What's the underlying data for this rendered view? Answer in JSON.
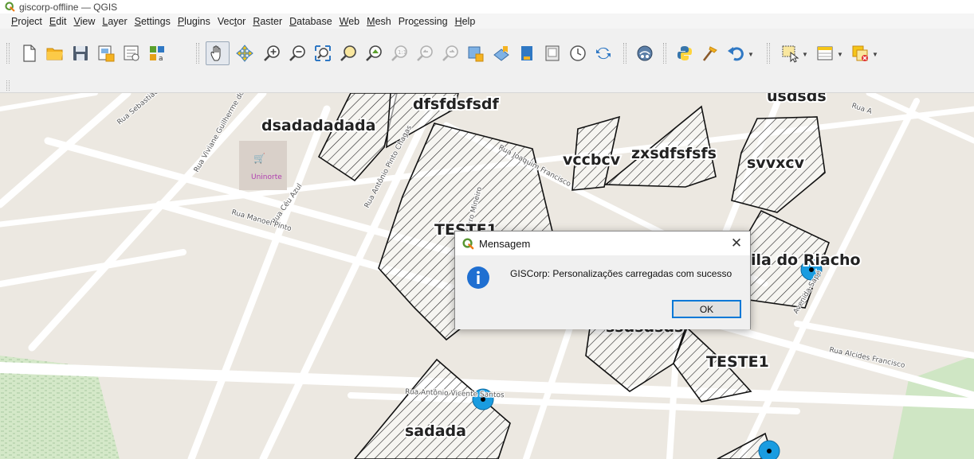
{
  "window": {
    "title": "giscorp-offline — QGIS"
  },
  "menu": {
    "items": [
      {
        "mnemonic": "P",
        "rest": "roject"
      },
      {
        "mnemonic": "E",
        "rest": "dit"
      },
      {
        "mnemonic": "V",
        "rest": "iew"
      },
      {
        "mnemonic": "L",
        "rest": "ayer"
      },
      {
        "mnemonic": "S",
        "rest": "ettings"
      },
      {
        "mnemonic": "P",
        "rest": "lugins"
      },
      {
        "pre": "Vec",
        "mnemonic": "t",
        "rest": "or"
      },
      {
        "mnemonic": "R",
        "rest": "aster"
      },
      {
        "mnemonic": "D",
        "rest": "atabase"
      },
      {
        "mnemonic": "W",
        "rest": "eb"
      },
      {
        "mnemonic": "M",
        "rest": "esh"
      },
      {
        "pre": "Pro",
        "mnemonic": "c",
        "rest": "essing"
      },
      {
        "mnemonic": "H",
        "rest": "elp"
      }
    ]
  },
  "toolbar": {
    "icons": [
      "new-project-icon",
      "open-project-icon",
      "save-project-icon",
      "new-print-layout-icon",
      "layout-manager-icon",
      "style-manager-icon",
      "pan-icon",
      "pan-to-selection-icon",
      "zoom-in-icon",
      "zoom-out-icon",
      "zoom-full-icon",
      "zoom-to-selection-icon",
      "zoom-to-layer-icon",
      "zoom-native-icon",
      "zoom-last-icon",
      "zoom-next-icon",
      "new-bookmark-icon",
      "show-bookmarks-icon",
      "temporal-controller-icon",
      "clock-icon",
      "refresh-icon",
      "plugin-icon",
      "python-console-icon",
      "processing-toolbox-icon",
      "undo-icon",
      "select-features-icon",
      "attribute-table-icon",
      "deselect-icon"
    ]
  },
  "map": {
    "polygon_labels": [
      "dsadadadada",
      "dfsfdsfsdf",
      "vccbcv",
      "zxsdfsfsfs",
      "svvxcv",
      "usdsds",
      "TESTE1",
      "ila do Riacho",
      "ssdsdsds",
      "TESTE1",
      "sadada"
    ],
    "street_labels": [
      "Rua Sebastião",
      "Rua Viviane Guilherme do S.",
      "Rua Céu Azul",
      "Rua Manoel Pinto",
      "Rua Antônio Pinto Chagas",
      "Rua Alcides Francisco",
      "Rua Antônio Vicente Santos",
      "Rua Alcides Francisco",
      "Avenida Sapé",
      "Rua A",
      "Rua Sul Ouro Mineiro",
      "Rua Joaquim Francisco"
    ],
    "poi_label": "Uninorte",
    "colors": {
      "background": "#f2efe9",
      "road": "#ffffff",
      "block": "#e6e2da",
      "polygon_stroke": "#111111",
      "point_fill": "#1a9ce0",
      "park": "#cfe6c4"
    }
  },
  "dialog": {
    "title": "Mensagem",
    "close_glyph": "✕",
    "message": "GISCorp: Personalizações carregadas com sucesso",
    "ok_label": "OK",
    "icon": "info-icon"
  }
}
